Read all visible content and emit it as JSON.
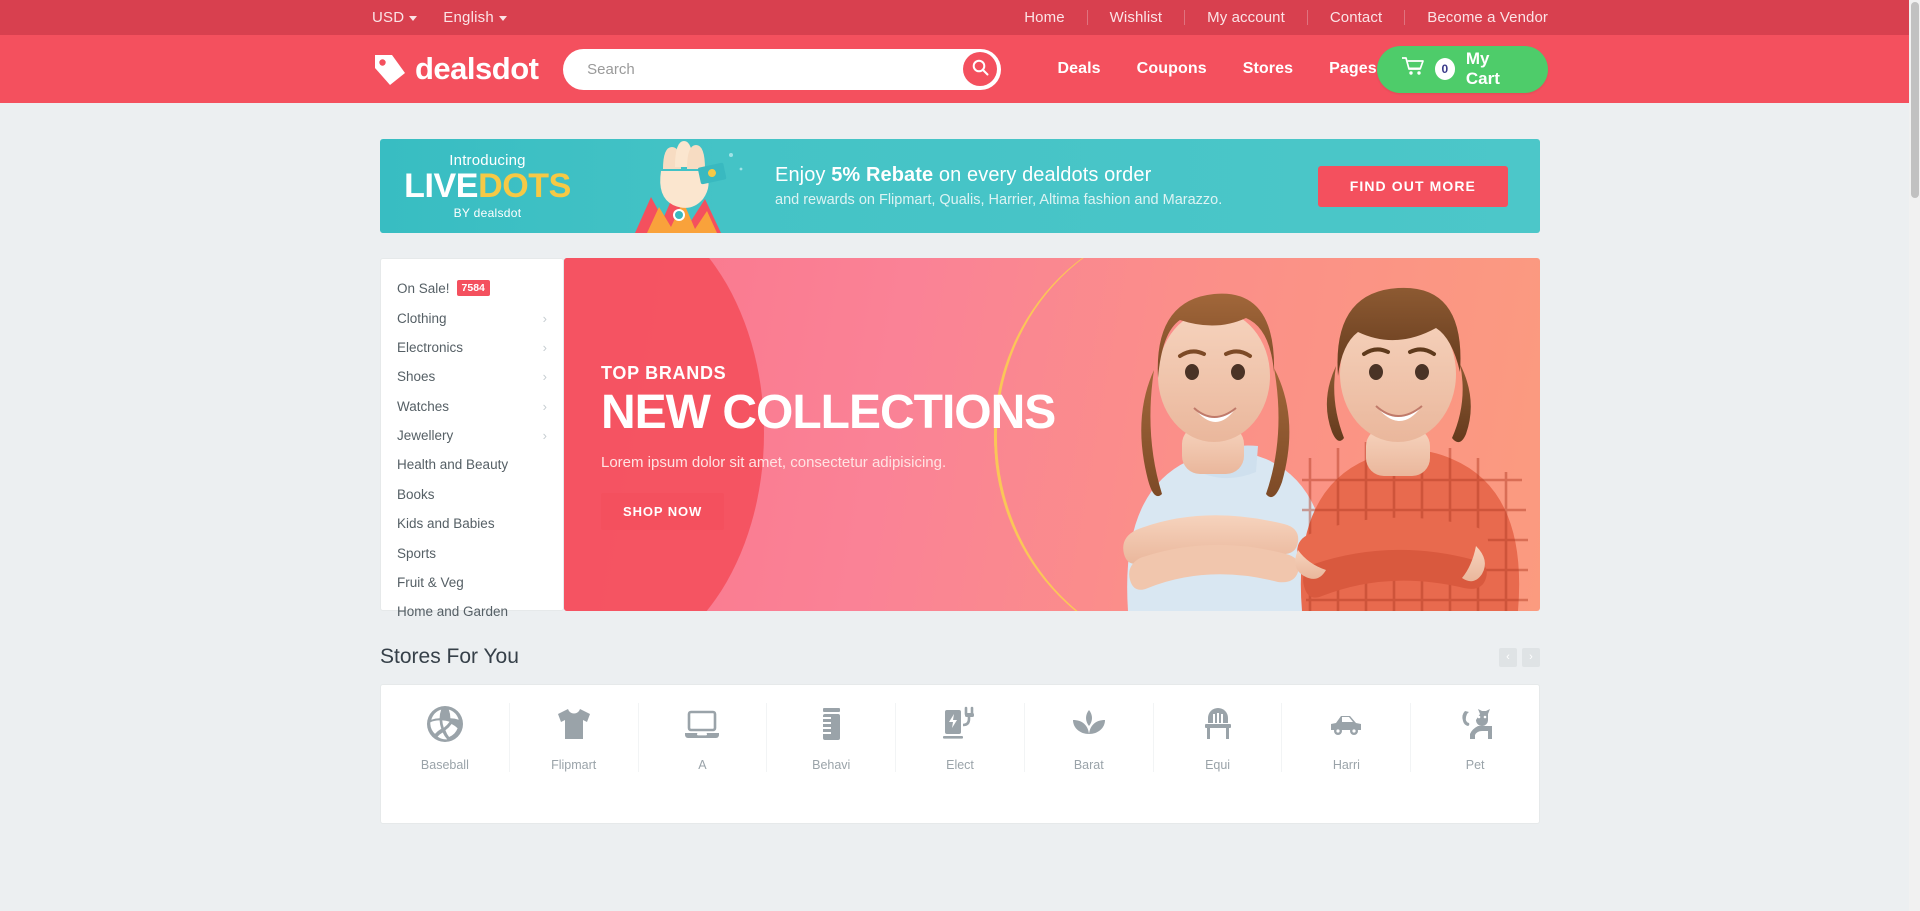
{
  "topbar": {
    "currency": "USD",
    "language": "English",
    "links": [
      "Home",
      "Wishlist",
      "My account",
      "Contact",
      "Become a Vendor"
    ]
  },
  "header": {
    "brand": "dealsdot",
    "logo_icon": "price-tag-icon",
    "search_placeholder": "Search",
    "search_value": "",
    "search_icon": "search-icon",
    "nav": [
      "Deals",
      "Coupons",
      "Stores",
      "Pages"
    ],
    "cart": {
      "icon": "shopping-cart-icon",
      "count": "0",
      "label": "My Cart"
    }
  },
  "promo": {
    "intro": "Introducing",
    "brand_live": "LIVE",
    "brand_dots": "DOTS",
    "by": "BY dealsdot",
    "heading_pre": "Enjoy ",
    "heading_bold": "5% Rebate",
    "heading_post": " on every dealdots order",
    "sub": "and rewards on Flipmart, Qualis, Harrier, Altima fashion and Marazzo.",
    "button": "FIND OUT MORE"
  },
  "categories": [
    {
      "label": "On Sale!",
      "badge": "7584",
      "chevron": false
    },
    {
      "label": "Clothing",
      "badge": "",
      "chevron": true
    },
    {
      "label": "Electronics",
      "badge": "",
      "chevron": true
    },
    {
      "label": "Shoes",
      "badge": "",
      "chevron": true
    },
    {
      "label": "Watches",
      "badge": "",
      "chevron": true
    },
    {
      "label": "Jewellery",
      "badge": "",
      "chevron": true
    },
    {
      "label": "Health and Beauty",
      "badge": "",
      "chevron": false
    },
    {
      "label": "Books",
      "badge": "",
      "chevron": false
    },
    {
      "label": "Kids and Babies",
      "badge": "",
      "chevron": false
    },
    {
      "label": "Sports",
      "badge": "",
      "chevron": false
    },
    {
      "label": "Fruit & Veg",
      "badge": "",
      "chevron": false
    },
    {
      "label": "Home and Garden",
      "badge": "",
      "chevron": false
    }
  ],
  "hero": {
    "kicker": "TOP BRANDS",
    "title": "NEW COLLECTIONS",
    "sub": "Lorem ipsum dolor sit amet, consectetur adipisicing.",
    "button": "SHOP NOW"
  },
  "stores": {
    "title": "Stores For You",
    "prev_icon": "chevron-left-icon",
    "next_icon": "chevron-right-icon",
    "items": [
      {
        "name": "Baseball",
        "icon": "basketball-icon"
      },
      {
        "name": "Flipmart",
        "icon": "tshirt-icon"
      },
      {
        "name": "A",
        "icon": "laptop-icon"
      },
      {
        "name": "Behavi",
        "icon": "container-icon"
      },
      {
        "name": "Elect",
        "icon": "ev-charger-icon"
      },
      {
        "name": "Barat",
        "icon": "lotus-icon"
      },
      {
        "name": "Equi",
        "icon": "chair-icon"
      },
      {
        "name": "Harri",
        "icon": "car-icon"
      },
      {
        "name": "Pet",
        "icon": "cat-icon"
      }
    ]
  },
  "colors": {
    "topbar": "#d8404f",
    "header": "#f4505e",
    "accent": "#f4505e",
    "cart_green": "#4ecc6a",
    "promo_teal": "#44c3c6",
    "promo_yellow": "#f6c945",
    "page_bg": "#eceff1"
  }
}
